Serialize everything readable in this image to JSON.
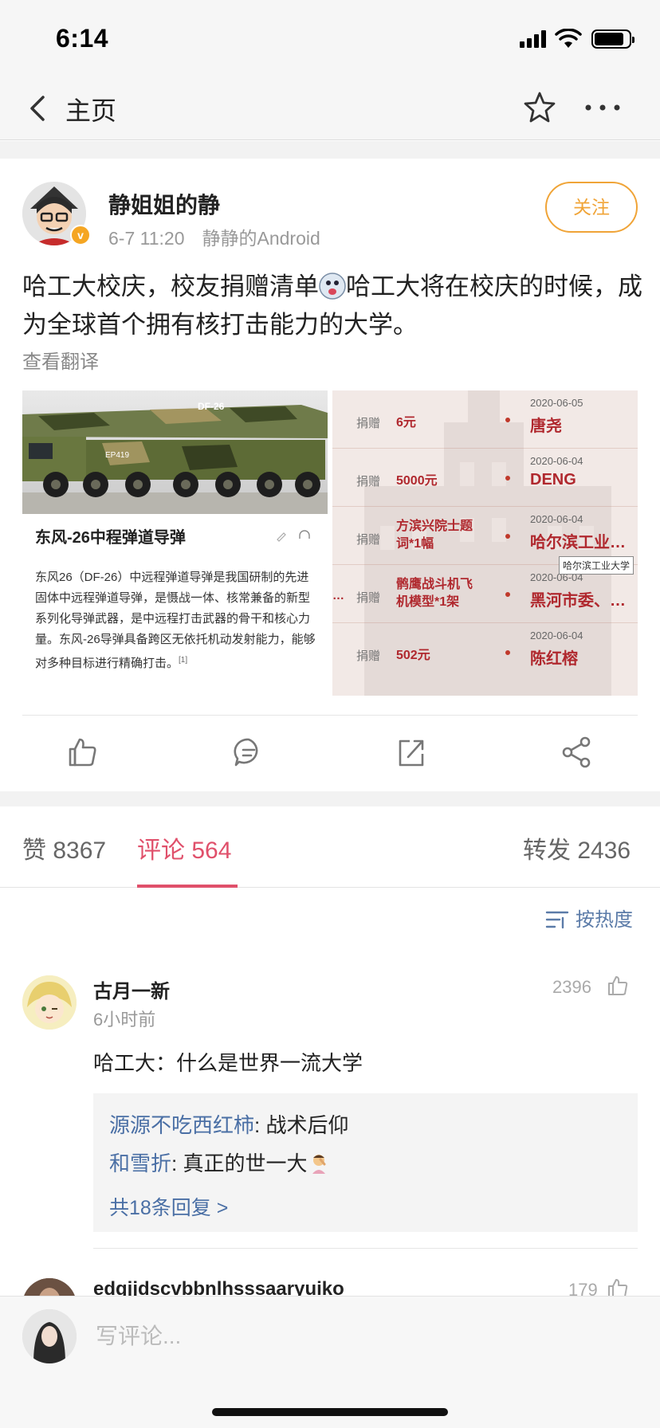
{
  "status_bar": {
    "time": "6:14"
  },
  "nav": {
    "back_label": "主页"
  },
  "post": {
    "username": "静姐姐的静",
    "time": "6-7 11:20",
    "source": "静静的Android",
    "follow_label": "关注",
    "text_part1": "哈工大校庆，校友捐赠清单",
    "text_part2": "哈工大将在校庆的时候，成为全球首个拥有核打击能力的大学。",
    "translate_label": "查看翻译",
    "image1": {
      "vehicle_text": "DF-26",
      "plate_text": "EP419",
      "title": "东风-26中程弹道导弹",
      "body": "东风26（DF-26）中远程弹道导弹是我国研制的先进固体中远程弹道导弹，是慑战一体、核常兼备的新型系列化导弹武器，是中远程打击武器的骨干和核心力量。东风-26导弹具备跨区无依托机动发射能力，能够对多种目标进行精确打击。",
      "footnote": "[1]"
    },
    "image2": {
      "donations": [
        {
          "label": "捐赠",
          "amount": "6元",
          "date": "2020-06-05",
          "donor": "唐尧"
        },
        {
          "label": "捐赠",
          "amount": "5000元",
          "date": "2020-06-04",
          "donor": "DENG"
        },
        {
          "label": "捐赠",
          "amount": "方滨兴院士题词*1幅",
          "date": "2020-06-04",
          "donor": "哈尔滨工业…"
        },
        {
          "label": "捐赠",
          "amount": "鹘鹰战斗机飞机模型*1架",
          "date": "2020-06-04",
          "donor": "黑河市委、…"
        },
        {
          "label": "捐赠",
          "amount": "502元",
          "date": "2020-06-04",
          "donor": "陈红榕"
        }
      ],
      "more_mark": "…",
      "tooltip": "哈尔滨工业大学"
    }
  },
  "tabs": {
    "likes": "赞 8367",
    "comments": "评论 564",
    "reposts": "转发 2436"
  },
  "sort_label": "按热度",
  "comments": [
    {
      "user": "古月一新",
      "time": "6小时前",
      "likes": "2396",
      "text": "哈工大：什么是世界一流大学",
      "replies": [
        {
          "user": "源源不吃西红柿",
          "text": ": 战术后仰"
        },
        {
          "user": "和雪折",
          "text": ": 真正的世一大"
        }
      ],
      "more_replies": "共18条回复 >"
    },
    {
      "user": "edgjjdscvbbnlhsssaaryuiko",
      "likes": "179"
    }
  ],
  "composer": {
    "placeholder": "写评论..."
  },
  "colors": {
    "accent": "#e0506b",
    "follow": "#f0a437",
    "link": "#4a6fa5",
    "donation_red": "#b0282e"
  },
  "icons": [
    "back-icon",
    "star-icon",
    "more-icon",
    "like-icon",
    "comment-icon",
    "repost-icon",
    "share-icon",
    "sort-icon",
    "thumb-up-icon"
  ]
}
